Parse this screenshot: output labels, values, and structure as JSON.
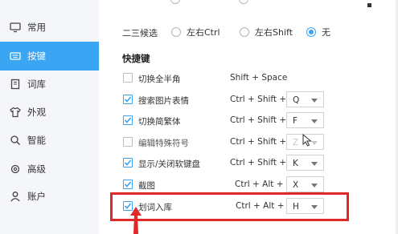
{
  "sidebar": {
    "items": [
      {
        "label": "常用",
        "icon": "monitor-icon",
        "active": false
      },
      {
        "label": "按键",
        "icon": "keyboard-icon",
        "active": true
      },
      {
        "label": "词库",
        "icon": "book-icon",
        "active": false
      },
      {
        "label": "外观",
        "icon": "shirt-icon",
        "active": false
      },
      {
        "label": "智能",
        "icon": "search-icon",
        "active": false
      },
      {
        "label": "高级",
        "icon": "gear-icon",
        "active": false
      },
      {
        "label": "账户",
        "icon": "user-icon",
        "active": false
      }
    ]
  },
  "candidate_select": {
    "label": "二三候选",
    "options": [
      {
        "label": "左右Ctrl",
        "checked": false
      },
      {
        "label": "左右Shift",
        "checked": false
      },
      {
        "label": "无",
        "checked": true
      }
    ]
  },
  "shortcuts": {
    "title": "快捷键",
    "rows": [
      {
        "name": "切换全半角",
        "checked": false,
        "combo": "Shift + Space",
        "key": null,
        "enabled": true
      },
      {
        "name": "搜索图片表情",
        "checked": true,
        "combo": "Ctrl + Shift +",
        "key": "Q",
        "enabled": true
      },
      {
        "name": "切换简繁体",
        "checked": true,
        "combo": "Ctrl + Shift +",
        "key": "F",
        "enabled": true
      },
      {
        "name": "编辑特殊符号",
        "checked": false,
        "combo": "Ctrl + Shift +",
        "key": "Z",
        "enabled": false
      },
      {
        "name": "显示/关闭软键盘",
        "checked": true,
        "combo": "Ctrl + Shift +",
        "key": "K",
        "enabled": true
      },
      {
        "name": "截图",
        "checked": true,
        "combo": "Ctrl + Alt +",
        "key": "X",
        "enabled": true
      },
      {
        "name": "划词入库",
        "checked": true,
        "combo": "Ctrl + Alt +",
        "key": "H",
        "enabled": true
      }
    ]
  },
  "colors": {
    "accent": "#3aa5f3",
    "highlight": "#e02828"
  }
}
